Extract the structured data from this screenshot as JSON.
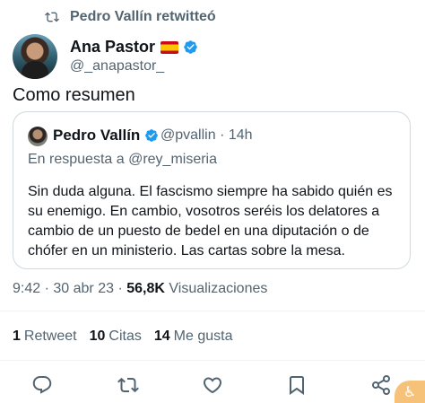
{
  "retweet": {
    "label": "Pedro Vallín retwitteó"
  },
  "author": {
    "name": "Ana Pastor",
    "handle": "@_anapastor_"
  },
  "tweet": {
    "text": "Como resumen"
  },
  "quote": {
    "name": "Pedro Vallín",
    "handle": "@pvallin",
    "time": "14h",
    "reply_to": "En respuesta a @rey_miseria",
    "body": "Sin duda alguna. El fascismo siempre ha sabido quién es su enemigo. En cambio, vosotros seréis los delatores a cambio de un puesto de bedel en una diputación o de chófer en un ministerio. Las cartas sobre la mesa."
  },
  "meta": {
    "time": "9:42",
    "date": "30 abr 23",
    "views_count": "56,8K",
    "views_label": "Visualizaciones"
  },
  "stats": {
    "retweets_count": "1",
    "retweets_label": "Retweet",
    "quotes_count": "10",
    "quotes_label": "Citas",
    "likes_count": "14",
    "likes_label": "Me gusta"
  },
  "icons": [
    "retweet-icon",
    "verified-icon",
    "reply-icon",
    "like-icon",
    "bookmark-icon",
    "share-icon",
    "accessibility-icon"
  ],
  "colors": {
    "verified": "#1d9bf0",
    "secondary_text": "#536471",
    "border": "#cfd9de"
  }
}
